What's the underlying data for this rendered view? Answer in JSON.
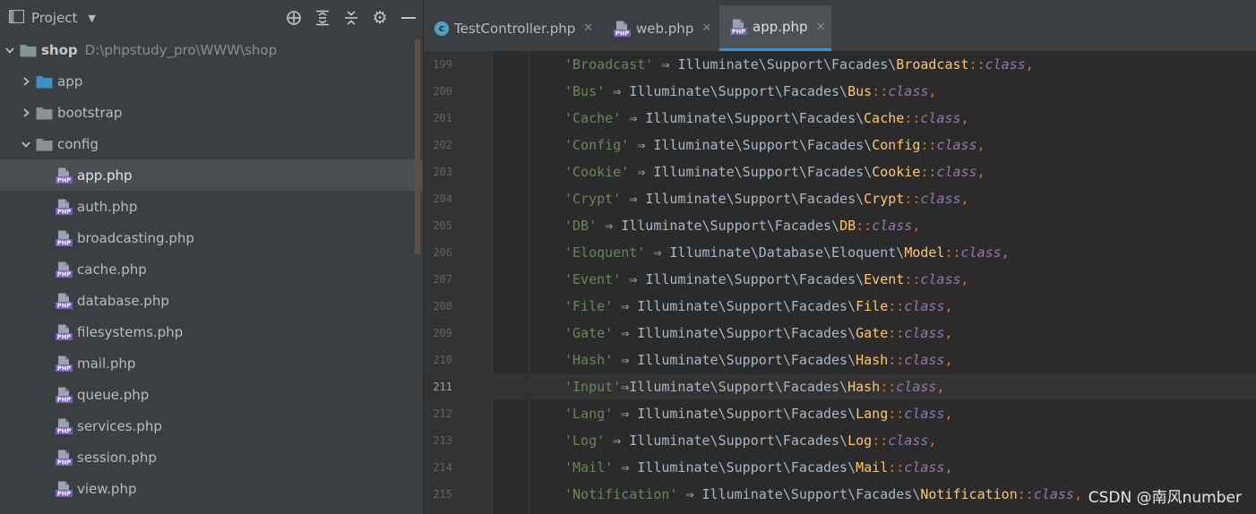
{
  "project": {
    "title": "Project",
    "tree": [
      {
        "label": "shop",
        "path": "D:\\phpstudy_pro\\WWW\\shop",
        "type": "folder",
        "expanded": true,
        "depth": 0
      },
      {
        "label": "app",
        "type": "folder",
        "expanded": false,
        "depth": 1
      },
      {
        "label": "bootstrap",
        "type": "folder",
        "expanded": false,
        "depth": 1
      },
      {
        "label": "config",
        "type": "folder",
        "expanded": true,
        "depth": 1
      },
      {
        "label": "app.php",
        "type": "php",
        "depth": 2,
        "selected": true
      },
      {
        "label": "auth.php",
        "type": "php",
        "depth": 2
      },
      {
        "label": "broadcasting.php",
        "type": "php",
        "depth": 2
      },
      {
        "label": "cache.php",
        "type": "php",
        "depth": 2
      },
      {
        "label": "database.php",
        "type": "php",
        "depth": 2
      },
      {
        "label": "filesystems.php",
        "type": "php",
        "depth": 2
      },
      {
        "label": "mail.php",
        "type": "php",
        "depth": 2
      },
      {
        "label": "queue.php",
        "type": "php",
        "depth": 2
      },
      {
        "label": "services.php",
        "type": "php",
        "depth": 2
      },
      {
        "label": "session.php",
        "type": "php",
        "depth": 2
      },
      {
        "label": "view.php",
        "type": "php",
        "depth": 2
      }
    ]
  },
  "tabs": [
    {
      "label": "TestController.php",
      "icon": "c-class-icon",
      "active": false
    },
    {
      "label": "web.php",
      "icon": "php-file-icon",
      "active": false
    },
    {
      "label": "app.php",
      "icon": "php-file-icon",
      "active": true
    }
  ],
  "editor": {
    "current_line": "211",
    "lines": [
      {
        "num": "199",
        "key": "'Broadcast'",
        "arrow": " ⇒ ",
        "ns": "Illuminate\\Support\\Facades\\",
        "cls": "Broadcast"
      },
      {
        "num": "200",
        "key": "'Bus'",
        "arrow": " ⇒ ",
        "ns": "Illuminate\\Support\\Facades\\",
        "cls": "Bus"
      },
      {
        "num": "201",
        "key": "'Cache'",
        "arrow": " ⇒ ",
        "ns": "Illuminate\\Support\\Facades\\",
        "cls": "Cache"
      },
      {
        "num": "202",
        "key": "'Config'",
        "arrow": " ⇒ ",
        "ns": "Illuminate\\Support\\Facades\\",
        "cls": "Config"
      },
      {
        "num": "203",
        "key": "'Cookie'",
        "arrow": " ⇒ ",
        "ns": "Illuminate\\Support\\Facades\\",
        "cls": "Cookie"
      },
      {
        "num": "204",
        "key": "'Crypt'",
        "arrow": " ⇒ ",
        "ns": "Illuminate\\Support\\Facades\\",
        "cls": "Crypt"
      },
      {
        "num": "205",
        "key": "'DB'",
        "arrow": " ⇒ ",
        "ns": "Illuminate\\Support\\Facades\\",
        "cls": "DB"
      },
      {
        "num": "206",
        "key": "'Eloquent'",
        "arrow": " ⇒ ",
        "ns": "Illuminate\\Database\\Eloquent\\",
        "cls": "Model"
      },
      {
        "num": "207",
        "key": "'Event'",
        "arrow": " ⇒ ",
        "ns": "Illuminate\\Support\\Facades\\",
        "cls": "Event"
      },
      {
        "num": "208",
        "key": "'File'",
        "arrow": " ⇒ ",
        "ns": "Illuminate\\Support\\Facades\\",
        "cls": "File"
      },
      {
        "num": "209",
        "key": "'Gate'",
        "arrow": " ⇒ ",
        "ns": "Illuminate\\Support\\Facades\\",
        "cls": "Gate"
      },
      {
        "num": "210",
        "key": "'Hash'",
        "arrow": " ⇒ ",
        "ns": "Illuminate\\Support\\Facades\\",
        "cls": "Hash"
      },
      {
        "num": "211",
        "key": "'Input'",
        "arrow": "⇒",
        "ns": "Illuminate\\Support\\Facades\\",
        "cls": "Hash"
      },
      {
        "num": "212",
        "key": "'Lang'",
        "arrow": " ⇒ ",
        "ns": "Illuminate\\Support\\Facades\\",
        "cls": "Lang"
      },
      {
        "num": "213",
        "key": "'Log'",
        "arrow": " ⇒ ",
        "ns": "Illuminate\\Support\\Facades\\",
        "cls": "Log"
      },
      {
        "num": "214",
        "key": "'Mail'",
        "arrow": " ⇒ ",
        "ns": "Illuminate\\Support\\Facades\\",
        "cls": "Mail"
      },
      {
        "num": "215",
        "key": "'Notification'",
        "arrow": " ⇒ ",
        "ns": "Illuminate\\Support\\Facades\\",
        "cls": "Notification"
      }
    ],
    "scope_op": "::",
    "class_kw": "class",
    "comma": ","
  },
  "watermark": "CSDN @南风number"
}
